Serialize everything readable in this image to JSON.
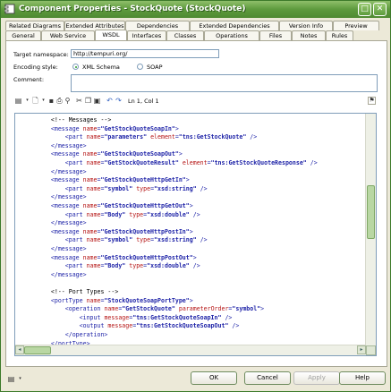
{
  "window": {
    "title": "Component Properties - StockQuote (StockQuote)",
    "colors": {
      "title_green": "#5d9a3d",
      "tag": "#1f24a8",
      "attr": "#b51414"
    }
  },
  "tabs_top": [
    "Related Diagrams",
    "Extended Attributes",
    "Dependencies",
    "Extended Dependencies",
    "Version Info",
    "Preview"
  ],
  "tabs_bottom": [
    "General",
    "Web Service",
    "WSDL",
    "Interfaces",
    "Classes",
    "Operations",
    "Files",
    "Notes",
    "Rules"
  ],
  "active_tab": "WSDL",
  "form": {
    "namespace_label": "Target namespace:",
    "namespace_value": "http://tempuri.org/",
    "encoding_label": "Encoding style:",
    "encoding_options": [
      "XML Schema",
      "SOAP"
    ],
    "encoding_selected": "XML Schema",
    "comment_label": "Comment:"
  },
  "toolbar": {
    "icons": [
      "properties-dropdown-icon",
      "new-dropdown-icon",
      "save-icon",
      "print-icon",
      "find-icon",
      "cut-icon",
      "copy-icon",
      "paste-icon",
      "undo-icon",
      "redo-icon"
    ],
    "position": "Ln 1, Col 1"
  },
  "code_lines": [
    [
      [
        "t-com",
        "    <!-- Messages -->"
      ]
    ],
    [
      [
        "t-tag",
        "    <message "
      ],
      [
        "t-attr",
        "name"
      ],
      [
        "t-tag",
        "="
      ],
      [
        "t-val",
        "\"GetStockQuoteSoapIn\""
      ],
      [
        "t-tag",
        ">"
      ]
    ],
    [
      [
        "t-tag",
        "        <part "
      ],
      [
        "t-attr",
        "name"
      ],
      [
        "t-tag",
        "="
      ],
      [
        "t-val",
        "\"parameters\""
      ],
      [
        "t-tag",
        " "
      ],
      [
        "t-attr",
        "element"
      ],
      [
        "t-tag",
        "="
      ],
      [
        "t-val",
        "\"tns:GetStockQuote\""
      ],
      [
        "t-tag",
        " />"
      ]
    ],
    [
      [
        "t-tag",
        "    </message>"
      ]
    ],
    [
      [
        "t-tag",
        "    <message "
      ],
      [
        "t-attr",
        "name"
      ],
      [
        "t-tag",
        "="
      ],
      [
        "t-val",
        "\"GetStockQuoteSoapOut\""
      ],
      [
        "t-tag",
        ">"
      ]
    ],
    [
      [
        "t-tag",
        "        <part "
      ],
      [
        "t-attr",
        "name"
      ],
      [
        "t-tag",
        "="
      ],
      [
        "t-val",
        "\"GetStockQuoteResult\""
      ],
      [
        "t-tag",
        " "
      ],
      [
        "t-attr",
        "element"
      ],
      [
        "t-tag",
        "="
      ],
      [
        "t-val",
        "\"tns:GetStockQuoteResponse\""
      ],
      [
        "t-tag",
        " />"
      ]
    ],
    [
      [
        "t-tag",
        "    </message>"
      ]
    ],
    [
      [
        "t-tag",
        "    <message "
      ],
      [
        "t-attr",
        "name"
      ],
      [
        "t-tag",
        "="
      ],
      [
        "t-val",
        "\"GetStockQuoteHttpGetIn\""
      ],
      [
        "t-tag",
        ">"
      ]
    ],
    [
      [
        "t-tag",
        "        <part "
      ],
      [
        "t-attr",
        "name"
      ],
      [
        "t-tag",
        "="
      ],
      [
        "t-val",
        "\"symbol\""
      ],
      [
        "t-tag",
        " "
      ],
      [
        "t-attr",
        "type"
      ],
      [
        "t-tag",
        "="
      ],
      [
        "t-val",
        "\"xsd:string\""
      ],
      [
        "t-tag",
        " />"
      ]
    ],
    [
      [
        "t-tag",
        "    </message>"
      ]
    ],
    [
      [
        "t-tag",
        "    <message "
      ],
      [
        "t-attr",
        "name"
      ],
      [
        "t-tag",
        "="
      ],
      [
        "t-val",
        "\"GetStockQuoteHttpGetOut\""
      ],
      [
        "t-tag",
        ">"
      ]
    ],
    [
      [
        "t-tag",
        "        <part "
      ],
      [
        "t-attr",
        "name"
      ],
      [
        "t-tag",
        "="
      ],
      [
        "t-val",
        "\"Body\""
      ],
      [
        "t-tag",
        " "
      ],
      [
        "t-attr",
        "type"
      ],
      [
        "t-tag",
        "="
      ],
      [
        "t-val",
        "\"xsd:double\""
      ],
      [
        "t-tag",
        " />"
      ]
    ],
    [
      [
        "t-tag",
        "    </message>"
      ]
    ],
    [
      [
        "t-tag",
        "    <message "
      ],
      [
        "t-attr",
        "name"
      ],
      [
        "t-tag",
        "="
      ],
      [
        "t-val",
        "\"GetStockQuoteHttpPostIn\""
      ],
      [
        "t-tag",
        ">"
      ]
    ],
    [
      [
        "t-tag",
        "        <part "
      ],
      [
        "t-attr",
        "name"
      ],
      [
        "t-tag",
        "="
      ],
      [
        "t-val",
        "\"symbol\""
      ],
      [
        "t-tag",
        " "
      ],
      [
        "t-attr",
        "type"
      ],
      [
        "t-tag",
        "="
      ],
      [
        "t-val",
        "\"xsd:string\""
      ],
      [
        "t-tag",
        " />"
      ]
    ],
    [
      [
        "t-tag",
        "    </message>"
      ]
    ],
    [
      [
        "t-tag",
        "    <message "
      ],
      [
        "t-attr",
        "name"
      ],
      [
        "t-tag",
        "="
      ],
      [
        "t-val",
        "\"GetStockQuoteHttpPostOut\""
      ],
      [
        "t-tag",
        ">"
      ]
    ],
    [
      [
        "t-tag",
        "        <part "
      ],
      [
        "t-attr",
        "name"
      ],
      [
        "t-tag",
        "="
      ],
      [
        "t-val",
        "\"Body\""
      ],
      [
        "t-tag",
        " "
      ],
      [
        "t-attr",
        "type"
      ],
      [
        "t-tag",
        "="
      ],
      [
        "t-val",
        "\"xsd:double\""
      ],
      [
        "t-tag",
        " />"
      ]
    ],
    [
      [
        "t-tag",
        "    </message>"
      ]
    ],
    [
      [
        "t-com",
        ""
      ]
    ],
    [
      [
        "t-com",
        "    <!-- Port Types -->"
      ]
    ],
    [
      [
        "t-tag",
        "    <portType "
      ],
      [
        "t-attr",
        "name"
      ],
      [
        "t-tag",
        "="
      ],
      [
        "t-val",
        "\"StockQuoteSoapPortType\""
      ],
      [
        "t-tag",
        ">"
      ]
    ],
    [
      [
        "t-tag",
        "        <operation "
      ],
      [
        "t-attr",
        "name"
      ],
      [
        "t-tag",
        "="
      ],
      [
        "t-val",
        "\"GetStockQuote\""
      ],
      [
        "t-tag",
        " "
      ],
      [
        "t-attr",
        "parameterOrder"
      ],
      [
        "t-tag",
        "="
      ],
      [
        "t-val",
        "\"symbol\""
      ],
      [
        "t-tag",
        ">"
      ]
    ],
    [
      [
        "t-tag",
        "            <input "
      ],
      [
        "t-attr",
        "message"
      ],
      [
        "t-tag",
        "="
      ],
      [
        "t-val",
        "\"tns:GetStockQuoteSoapIn\""
      ],
      [
        "t-tag",
        " />"
      ]
    ],
    [
      [
        "t-tag",
        "            <output "
      ],
      [
        "t-attr",
        "message"
      ],
      [
        "t-tag",
        "="
      ],
      [
        "t-val",
        "\"tns:GetStockQuoteSoapOut\""
      ],
      [
        "t-tag",
        " />"
      ]
    ],
    [
      [
        "t-tag",
        "        </operation>"
      ]
    ],
    [
      [
        "t-tag",
        "    </portType>"
      ]
    ]
  ],
  "buttons": {
    "ok": "OK",
    "cancel": "Cancel",
    "apply": "Apply",
    "help": "Help"
  }
}
